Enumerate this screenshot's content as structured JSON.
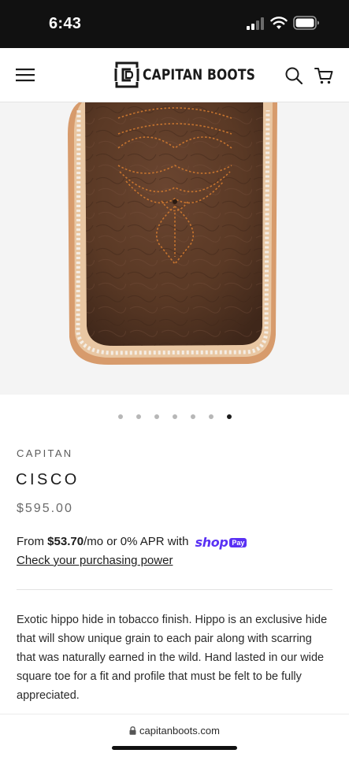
{
  "status_bar": {
    "time": "6:43"
  },
  "header": {
    "logo_text": "CAPITAN BOOTS",
    "menu_icon": "hamburger-menu-icon",
    "search_icon": "search-icon",
    "cart_icon": "cart-icon"
  },
  "gallery": {
    "image_alt": "Cisco hippo boot square toe close-up",
    "dot_count": 7,
    "active_index": 6
  },
  "product": {
    "brand": "CAPITAN",
    "title": "CISCO",
    "price": "$595.00"
  },
  "financing": {
    "from_label": "From ",
    "amount": "$53.70",
    "terms": "/mo or 0% APR with",
    "shop_word": "shop",
    "pay_badge": "Pay",
    "link_label": "Check your purchasing power"
  },
  "description": "Exotic hippo hide in tobacco finish. Hippo is an exclusive hide that will show unique grain to each pair along with scarring that was naturally earned in the wild. Hand lasted in our wide square toe for a fit and profile that must be felt to be fully appreciated.",
  "browser": {
    "url": "capitanboots.com"
  },
  "colors": {
    "shop_pay_purple": "#5a31f4",
    "leather_brown": "#5e3b27",
    "stitch_orange": "#c8752f"
  }
}
